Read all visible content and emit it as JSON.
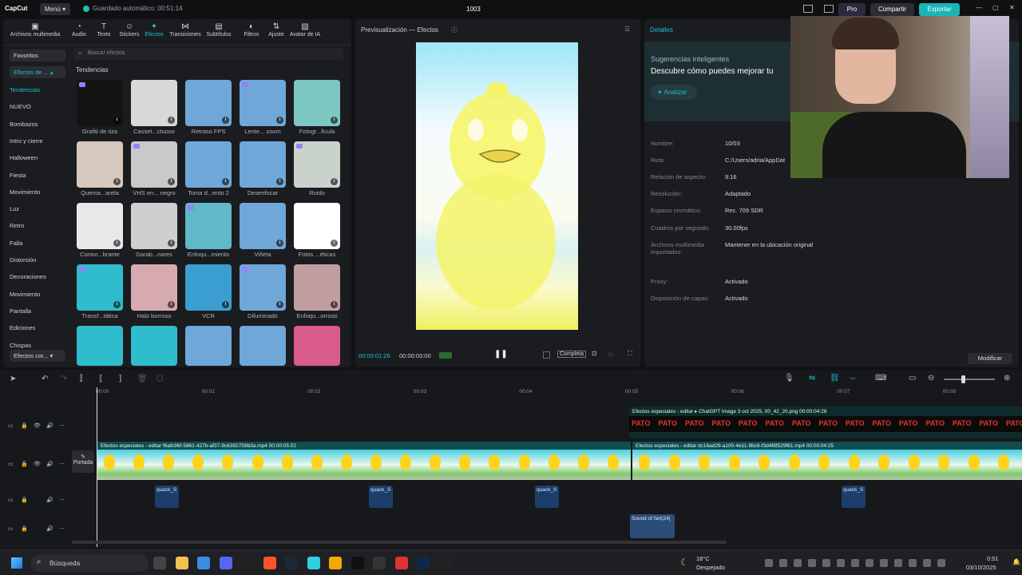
{
  "app": {
    "brand": "CapCut",
    "menu": "Menú",
    "autosave": "Guardado automático: 00:51:14",
    "title": "1003",
    "pro": "Pro",
    "share": "Compartir",
    "export": "Exportar"
  },
  "toolbar": [
    {
      "label": "Archivos multimedia",
      "icon": "media-icon"
    },
    {
      "label": "Audio",
      "icon": "audio-icon"
    },
    {
      "label": "Texto",
      "icon": "text-icon"
    },
    {
      "label": "Stickers",
      "icon": "sticker-icon"
    },
    {
      "label": "Efectos",
      "icon": "effects-icon"
    },
    {
      "label": "Transiciones",
      "icon": "transitions-icon"
    },
    {
      "label": "Subtítulos",
      "icon": "subtitles-icon"
    },
    {
      "label": "Filtros",
      "icon": "filters-icon"
    },
    {
      "label": "Ajuste",
      "icon": "adjust-icon"
    },
    {
      "label": "Avatar de IA",
      "icon": "avatar-icon"
    }
  ],
  "sidebar": {
    "favorites": "Favoritos",
    "effects_dropdown": "Efectos de ...",
    "items": [
      "Tendencias",
      "NUEVO",
      "Bombazos",
      "Intro y cierre",
      "Halloween",
      "Fiesta",
      "Movimiento",
      "Luz",
      "Retro",
      "Falla",
      "Distorsión",
      "Decoraciones",
      "Movimiento",
      "Pantalla",
      "Ediciones",
      "Chispas"
    ],
    "bottom_dropdown": "Efectos cor..."
  },
  "search": {
    "placeholder": "Buscar efectos"
  },
  "section_title": "Tendencias",
  "effects": [
    "Grafiti de tiza",
    "Casset...ctuoso",
    "Retraso FPS",
    "Lente... zoom",
    "Fotogr...llcula",
    "Quema...arela",
    "VHS en... negro",
    "Toma d...ento 2",
    "Desenfocar",
    "Ruido",
    "Contor...brante",
    "Garab...nares",
    "Enfoqu...miento",
    "Viñeta",
    "Fotos ...éticas",
    "Transf...tática",
    "Halo borroso",
    "VCR",
    "Difuminado",
    "Enfoqu...orroso"
  ],
  "preview": {
    "title": "Previsualización — Efectos",
    "current_time": "00:00:01:26",
    "total_time": "00:00:03:00",
    "ratio_button": "Completa"
  },
  "details": {
    "tab": "Detalles",
    "suggest_title": "Sugerencias inteligentes",
    "suggest_text": "Descubre cómo puedes mejorar tu",
    "analyze": "Analizar",
    "rows": [
      {
        "label": "Nombre:",
        "value": "10/03"
      },
      {
        "label": "Ruta:",
        "value": "C:/Users/adria/AppDat"
      },
      {
        "label": "Relación de aspecto:",
        "value": "9:16"
      },
      {
        "label": "Resolución:",
        "value": "Adaptado"
      },
      {
        "label": "Espacio cromático:",
        "value": "Rec. 709 SDR"
      },
      {
        "label": "Cuadros por segundo:",
        "value": "30.00fps"
      },
      {
        "label": "Archivos multimedia importados:",
        "value": "Mantener en la ubicación original"
      },
      {
        "label": "Proxy:",
        "value": "Activado"
      },
      {
        "label": "Disposición de capas:",
        "value": "Activado"
      }
    ],
    "modify": "Modificar"
  },
  "timeline": {
    "ticks": [
      "00:00",
      "00:01",
      "00:02",
      "00:03",
      "00:04",
      "00:05",
      "00:06",
      "00:07",
      "00:08"
    ],
    "cover_label": "Portada",
    "clip_img": "Efectos especiales - editar ▸  ChatGPT Image 3 oct 2025, 00_42_20.png  00:00:04:26",
    "pato": "PATO",
    "clip_main1": "Efectos especiales - editar  f6afc96f-5861-427b-af37-9c6392759b3a.mp4  00:00:05:02",
    "clip_main2": "Efectos especiales - editar  dc16ad29-a100-4e11-9bc6-f3d4f8f529f61.mp4  00:00:04:25",
    "audio_clips": [
      "quack_S",
      "quack_S",
      "quack_S",
      "quack_S"
    ],
    "fart": "Sound of fart(24("
  },
  "taskbar": {
    "search": "Búsqueda",
    "temp": "18°C",
    "weather": "Despejado",
    "time": "0:51",
    "date": "03/10/2025"
  }
}
